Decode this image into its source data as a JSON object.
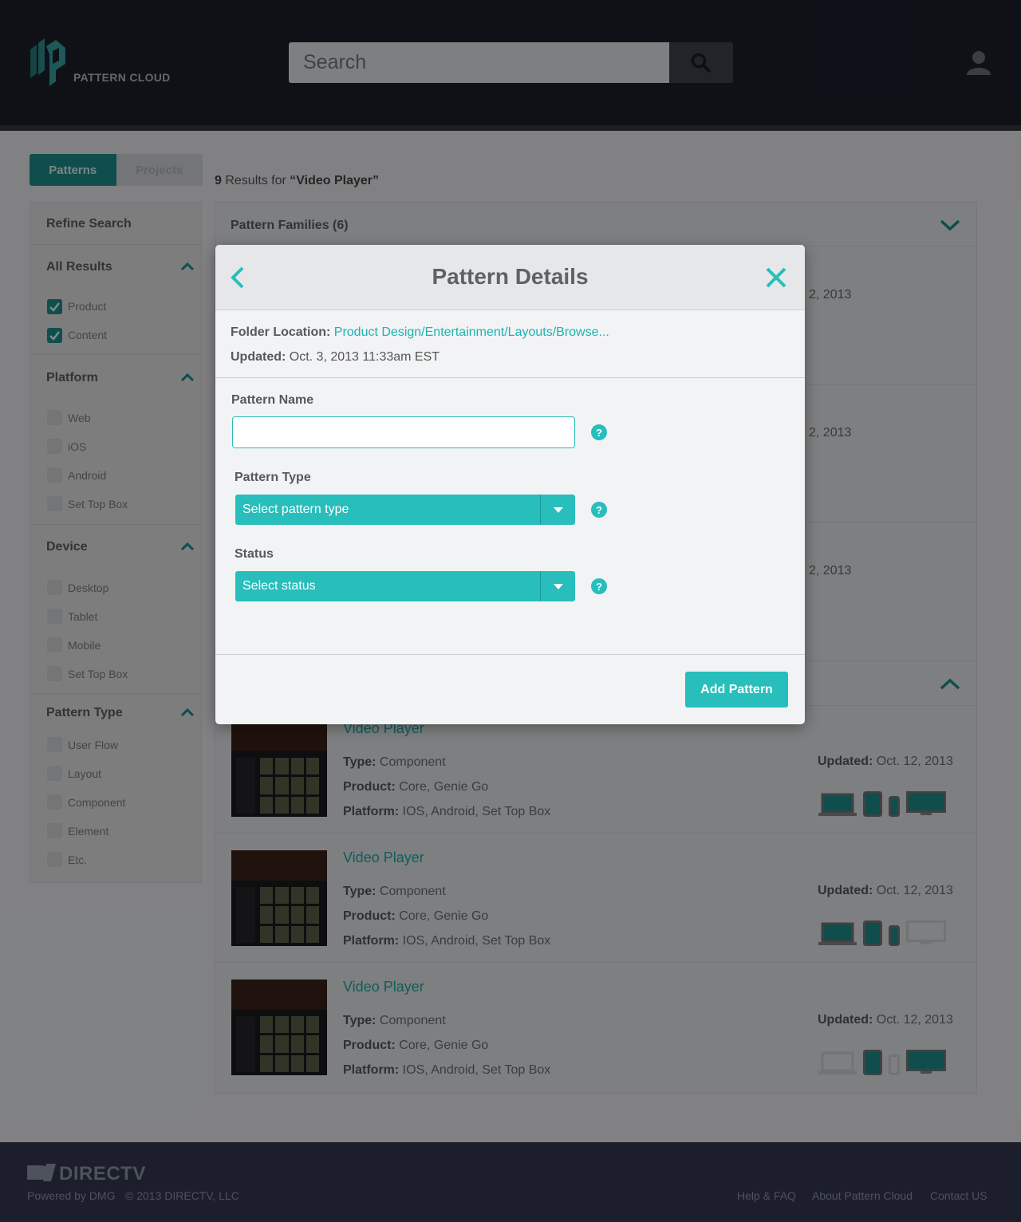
{
  "header": {
    "logo_text": "PATTERN CLOUD",
    "search_placeholder": "Search"
  },
  "tabs": [
    {
      "label": "Patterns",
      "active": true
    },
    {
      "label": "Projects",
      "active": false
    }
  ],
  "results": {
    "count": "9",
    "text": " Results for ",
    "query": "“Video Player”"
  },
  "sidebar": {
    "title": "Refine Search",
    "sections": [
      {
        "title": "All Results",
        "items": [
          {
            "label": "Product",
            "checked": true
          },
          {
            "label": "Content",
            "checked": true
          }
        ]
      },
      {
        "title": "Platform",
        "items": [
          {
            "label": "Web",
            "checked": false
          },
          {
            "label": "iOS",
            "checked": false
          },
          {
            "label": "Android",
            "checked": false
          },
          {
            "label": "Set Top Box",
            "checked": false
          }
        ]
      },
      {
        "title": "Device",
        "items": [
          {
            "label": "Desktop",
            "checked": false
          },
          {
            "label": "Tablet",
            "checked": false
          },
          {
            "label": "Mobile",
            "checked": false
          },
          {
            "label": "Set Top Box",
            "checked": false
          }
        ]
      },
      {
        "title": "Pattern Type",
        "items": [
          {
            "label": "User Flow",
            "checked": false
          },
          {
            "label": "Layout",
            "checked": false
          },
          {
            "label": "Component",
            "checked": false
          },
          {
            "label": "Element",
            "checked": false
          },
          {
            "label": "Etc.",
            "checked": false
          }
        ]
      }
    ]
  },
  "main": {
    "families_title": "Pattern Families (6)",
    "bg_dates": [
      "2, 2013",
      "2, 2013",
      "2, 2013"
    ],
    "items": [
      {
        "title": "Video Player",
        "type_label": "Type:",
        "type": " Component",
        "product_label": "Product:",
        "product": " Core, Genie Go",
        "platform_label": "Platform:",
        "platform": " IOS, Android, Set Top Box",
        "updated_label": "Updated:",
        "updated": " Oct. 12, 2013"
      },
      {
        "title": "Video Player",
        "type_label": "Type:",
        "type": " Component",
        "product_label": "Product:",
        "product": " Core, Genie Go",
        "platform_label": "Platform:",
        "platform": " IOS, Android, Set Top Box",
        "updated_label": "Updated:",
        "updated": " Oct. 12, 2013"
      },
      {
        "title": "Video Player",
        "type_label": "Type:",
        "type": " Component",
        "product_label": "Product:",
        "product": " Core, Genie Go",
        "platform_label": "Platform:",
        "platform": " IOS, Android, Set Top Box",
        "updated_label": "Updated:",
        "updated": " Oct. 12, 2013"
      }
    ]
  },
  "modal": {
    "title": "Pattern Details",
    "folder_label": "Folder Location:",
    "folder_value": "Product Design/Entertainment/Layouts/Browse...",
    "updated_label": "Updated:",
    "updated_value": " Oct. 3, 2013 11:33am EST",
    "name_label": "Pattern Name",
    "name_value": "",
    "type_label": "Pattern Type",
    "type_value": "Select pattern type",
    "status_label": "Status",
    "status_value": "Select status",
    "help_glyph": "?",
    "submit_label": "Add Pattern"
  },
  "footer": {
    "brand": "DIRECTV",
    "powered": "Powered by DMG",
    "copyright": "© 2013 DIRECTV, LLC",
    "links": [
      "Help & FAQ",
      "About Pattern Cloud",
      "Contact US"
    ]
  },
  "colors": {
    "accent": "#27bebb",
    "header_bg": "#1c1f2b",
    "tab_active": "#1d8f8d"
  }
}
